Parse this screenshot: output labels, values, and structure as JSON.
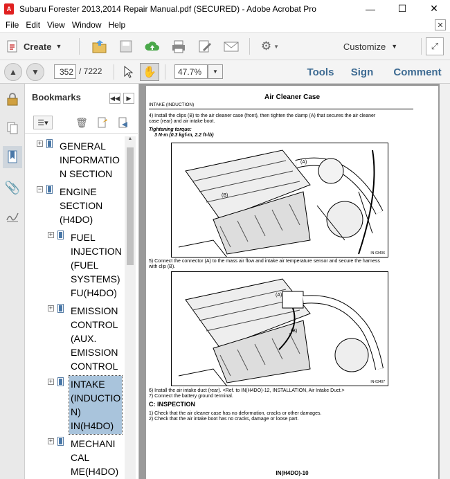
{
  "window": {
    "title": "Subaru Forester 2013,2014 Repair Manual.pdf (SECURED) - Adobe Acrobat Pro",
    "icon": "adobe-pdf-icon",
    "minimize": "—",
    "maximize": "☐",
    "close": "✕"
  },
  "menu": {
    "items": [
      "File",
      "Edit",
      "View",
      "Window",
      "Help"
    ],
    "close": "✕"
  },
  "toolbar": {
    "create": "Create",
    "customize": "Customize",
    "page_current": "352",
    "page_total": "/ 7222",
    "zoom": "47.7%",
    "tools": "Tools",
    "sign": "Sign",
    "comment": "Comment"
  },
  "bookmarks": {
    "title": "Bookmarks",
    "items": [
      {
        "lines": [
          "GENERAL",
          "INFORMATIO",
          "N SECTION"
        ]
      },
      {
        "lines": [
          "ENGINE",
          "SECTION",
          "(H4DO)"
        ]
      },
      {
        "lines": [
          "FUEL",
          "INJECTION",
          "(FUEL",
          "SYSTEMS)",
          "FU(H4DO)"
        ]
      },
      {
        "lines": [
          "EMISSION",
          "CONTROL",
          "(AUX.",
          "EMISSION",
          "CONTROL"
        ]
      },
      {
        "lines": [
          "INTAKE",
          "(INDUCTIO",
          "N)",
          "IN(H4DO)"
        ]
      },
      {
        "lines": [
          "MECHANI",
          "CAL",
          "ME(H4DO)"
        ]
      }
    ]
  },
  "page": {
    "title": "Air Cleaner Case",
    "subtitle": "INTAKE (INDUCTION)",
    "step4": "4) Install the clips (B) to the air cleaner case (front), then tighten the clamp (A) that secures the air cleaner",
    "step4b": "case (rear) and air intake boot.",
    "torque_label": "Tightening torque:",
    "torque_value": "3 N·m (0.3 kgf-m, 2.2 ft-lb)",
    "fig1_id": "IN-03406",
    "step5": "5) Connect the connector (A) to the mass air flow and intake air temperature sensor and secure the harness",
    "step5b": "with clip (B).",
    "fig2_id": "IN-03407",
    "step6": "6) Install the air intake duct (rear). <Ref. to IN(H4DO)-12, INSTALLATION, Air Intake Duct.>",
    "step7": "7) Connect the battery ground terminal.",
    "section": "C:  INSPECTION",
    "insp1": "1) Check that the air cleaner case has no deformation, cracks or other damages.",
    "insp2": "2) Check that the air intake boot has no cracks, damage or loose part.",
    "footer": "IN(H4DO)-10",
    "label_a": "(A)",
    "label_b": "(B)"
  }
}
